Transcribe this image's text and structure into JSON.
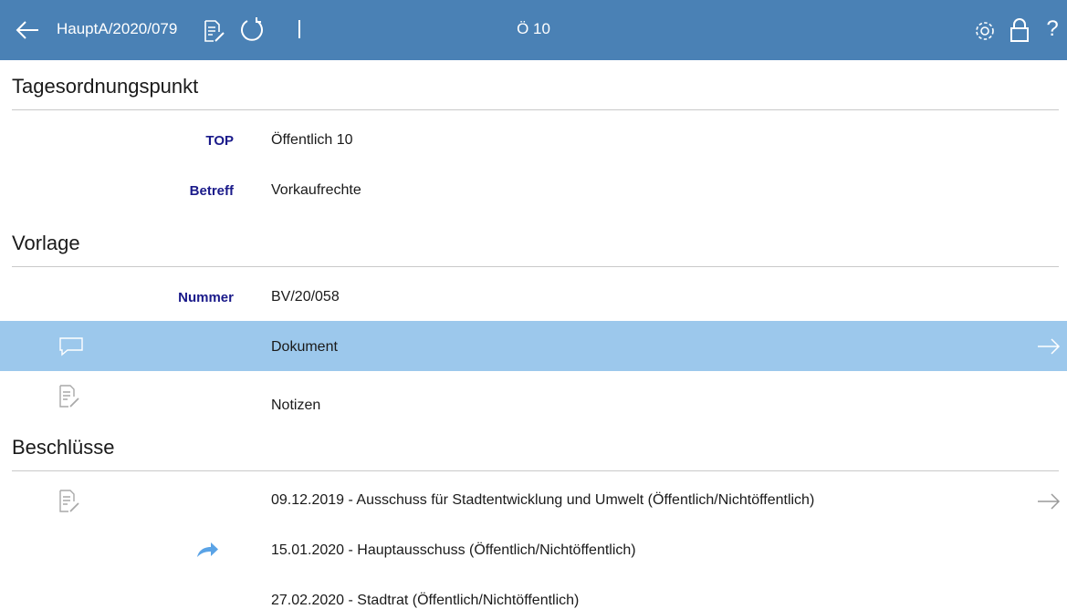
{
  "header": {
    "back_icon": "arrow-left-icon",
    "meeting_ref": "HauptA/2020/079",
    "notes_icon": "document-edit-icon",
    "refresh_icon": "refresh-icon",
    "agenda_item": "Ö 10",
    "settings_icon": "gear-icon",
    "lock_icon": "lock-icon",
    "help_label": "?"
  },
  "sections": {
    "agenda": {
      "title": "Tagesordnungspunkt",
      "top_label": "TOP",
      "top_value": "Öffentlich 10",
      "subject_label": "Betreff",
      "subject_value": "Vorkaufrechte"
    },
    "proposal": {
      "title": "Vorlage",
      "number_label": "Nummer",
      "number_value": "BV/20/058",
      "document_label": "Dokument",
      "notes_label": "Notizen"
    },
    "decisions": {
      "title": "Beschlüsse",
      "items": [
        {
          "text": "09.12.2019 - Ausschuss für Stadtentwicklung und Umwelt (Öffentlich/Nichtöffentlich)"
        },
        {
          "text": "15.01.2020 - Hauptausschuss (Öffentlich/Nichtöffentlich)"
        },
        {
          "text": "27.02.2020 - Stadtrat (Öffentlich/Nichtöffentlich)"
        }
      ]
    }
  },
  "colors": {
    "header_bg": "#4a81b5",
    "highlight_row": "#9cc8ec",
    "label_text": "#1a1a8a",
    "forward_arrow": "#5aa3e6"
  }
}
